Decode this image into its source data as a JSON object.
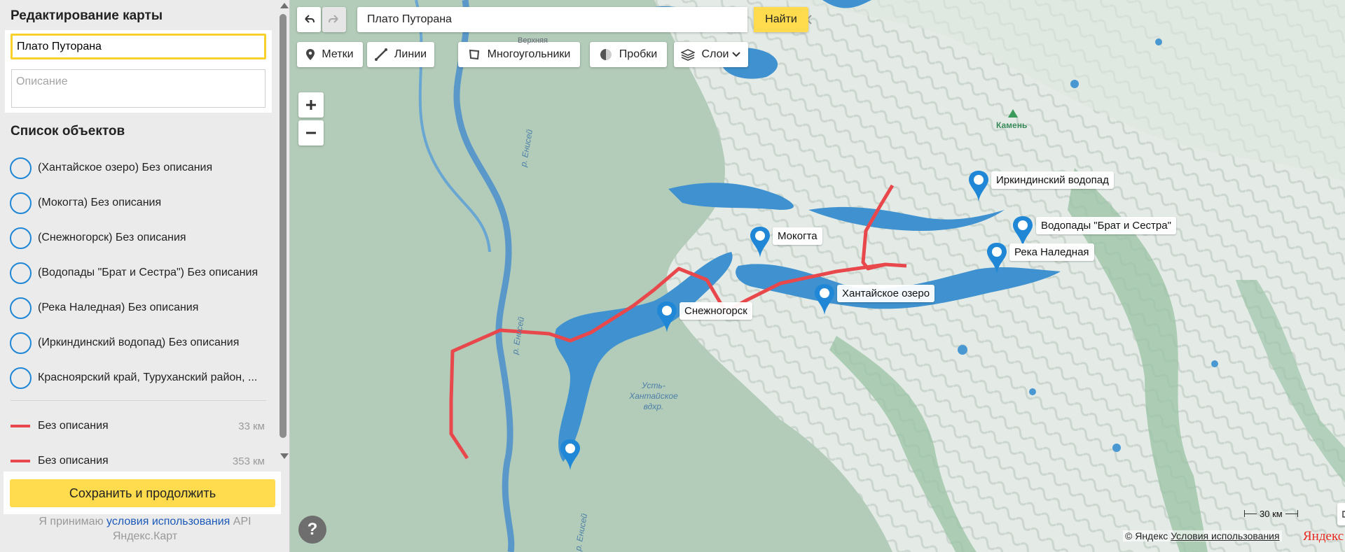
{
  "panel": {
    "title": "Редактирование карты",
    "name_value": "Плато Путорана",
    "description_placeholder": "Описание",
    "objects_title": "Список объектов",
    "objects": [
      {
        "label": "(Хантайское озеро) Без описания"
      },
      {
        "label": "(Мокогта) Без описания"
      },
      {
        "label": "(Снежногорск) Без описания"
      },
      {
        "label": "(Водопады \"Брат и Сестра\") Без описания"
      },
      {
        "label": "(Река Наледная) Без описания"
      },
      {
        "label": "(Иркиндинский водопад) Без описания"
      },
      {
        "label": "Красноярский край, Туруханский район, ..."
      }
    ],
    "lines": [
      {
        "label": "Без описания",
        "distance": "33 км"
      },
      {
        "label": "Без описания",
        "distance": "353 км"
      }
    ],
    "save_label": "Сохранить и продолжить",
    "terms_prefix": "Я принимаю ",
    "terms_link": "условия использования",
    "terms_suffix": " API Яндекс.Карт"
  },
  "map": {
    "search_value": "Плато Путорана",
    "find_label": "Найти",
    "tools": {
      "marks": "Метки",
      "lines": "Линии",
      "polygons": "Многоугольники",
      "traffic": "Пробки",
      "layers": "Слои"
    },
    "placemarks": [
      {
        "label": "Иркиндинский водопад"
      },
      {
        "label": "Водопады \"Брат и Сестра\""
      },
      {
        "label": "Река Наледная"
      },
      {
        "label": "Мокогта"
      },
      {
        "label": "Хантайское озеро"
      },
      {
        "label": "Снежногорск"
      }
    ],
    "map_labels": {
      "yenisei_1": "р. Енисей",
      "yenisei_2": "р. Енисей",
      "yenisei_3": "р. Енисей",
      "reservoir": "Усть-\nХантайское\nвдхр.",
      "kamen": "Камень",
      "top_label": "Верхняя"
    },
    "scale": "30 км",
    "copyright": "© Яндекс",
    "terms_link": "Условия использования",
    "logo": "Яндекс",
    "accent_color": "#ffdb4d",
    "route_color": "#e8484c",
    "pin_color": "#1f87d6",
    "icons": [
      "undo-icon",
      "redo-icon",
      "list-icon",
      "clear-icon",
      "pin-icon",
      "line-icon",
      "polygon-icon",
      "traffic-icon",
      "layers-icon",
      "plus-icon",
      "minus-icon",
      "help-icon",
      "ruler-icon"
    ]
  }
}
